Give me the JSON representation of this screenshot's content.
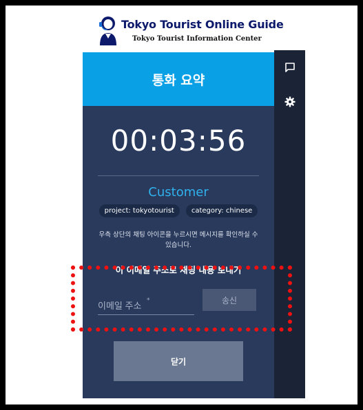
{
  "logo": {
    "title": "Tokyo Tourist Online Guide",
    "subtitle": "Tokyo Tourist Information Center"
  },
  "panel": {
    "header_title": "통화 요약",
    "timer": "00:03:56",
    "customer_label": "Customer",
    "tags": [
      {
        "label": "project: tokyotourist"
      },
      {
        "label": "category: chinese"
      }
    ],
    "hint": "우측 상단의 채팅 아이콘을 누르시면 메시지를 확인하실 수 있습니다.",
    "email_section_title": "이 이메일 주소로 채팅 내용 보내기",
    "email_placeholder": "이메일 주소",
    "email_required_mark": "*",
    "send_label": "송신",
    "close_label": "닫기"
  },
  "sidebar": {
    "icons": [
      "chat-icon",
      "gear-icon"
    ]
  },
  "colors": {
    "header_blue": "#0aa0e6",
    "panel_bg": "#2a3a5c",
    "sidebar_bg": "#1a2436",
    "accent_customer": "#2fb2ee",
    "highlight_red": "#ee1111"
  }
}
